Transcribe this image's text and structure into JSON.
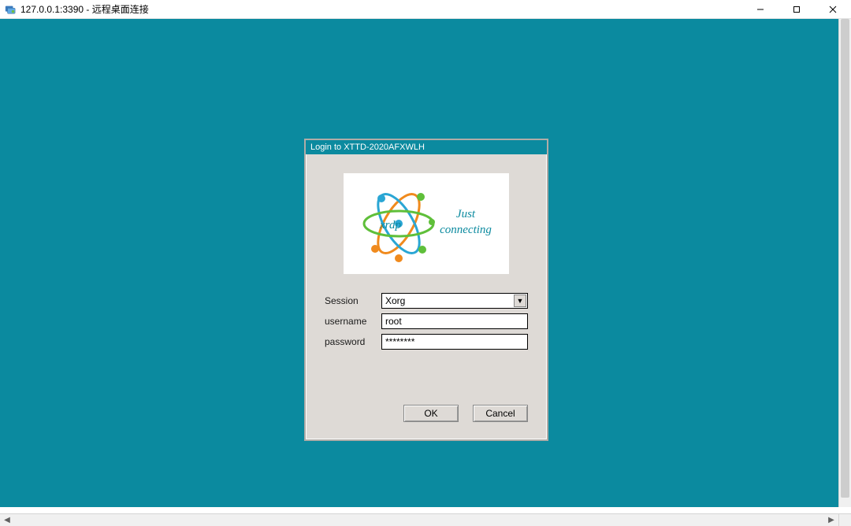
{
  "window": {
    "title": "127.0.0.1:3390 - 远程桌面连接"
  },
  "login_dialog": {
    "title": "Login to XTTD-2020AFXWLH",
    "logo_text_brand": "xrdp",
    "logo_text_line1": "Just",
    "logo_text_line2": "connecting",
    "labels": {
      "session": "Session",
      "username": "username",
      "password": "password"
    },
    "values": {
      "session_selected": "Xorg",
      "username": "root",
      "password_masked": "********"
    },
    "buttons": {
      "ok": "OK",
      "cancel": "Cancel"
    }
  },
  "colors": {
    "desktop_teal": "#0b8a9f",
    "dialog_bg": "#dedad6",
    "titlebar_bg": "#0b8a9f"
  }
}
